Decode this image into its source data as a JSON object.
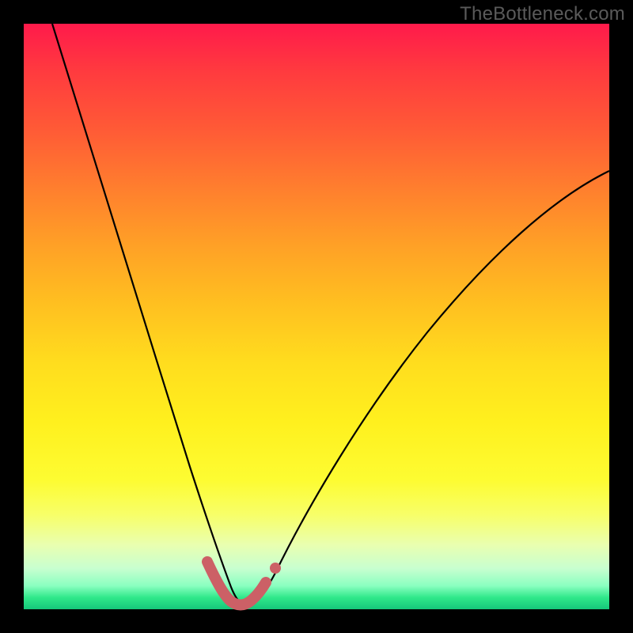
{
  "watermark": "TheBottleneck.com",
  "colors": {
    "curve": "#000000",
    "highlight": "#cc6066",
    "gradient_top": "#ff1a4b",
    "gradient_bottom": "#16c77a",
    "frame": "#000000"
  },
  "chart_data": {
    "type": "line",
    "title": "",
    "xlabel": "",
    "ylabel": "",
    "xlim": [
      0,
      100
    ],
    "ylim": [
      0,
      100
    ],
    "note": "V-shaped bottleneck curve on rainbow gradient; no axis ticks or numeric labels rendered. Values below are estimated from pixel geometry (y = 0 at bottom, 100 at top).",
    "series": [
      {
        "name": "bottleneck-curve",
        "x": [
          5,
          10,
          15,
          20,
          25,
          28,
          30,
          32,
          34,
          35,
          37,
          40,
          45,
          50,
          55,
          60,
          65,
          70,
          75,
          80,
          85,
          90,
          95,
          100
        ],
        "y": [
          100,
          82,
          63,
          44,
          25,
          13,
          7,
          3,
          1,
          0,
          0,
          2,
          9,
          18,
          26,
          33,
          39,
          45,
          50,
          54,
          58,
          61,
          64,
          66
        ]
      },
      {
        "name": "valley-highlight",
        "x": [
          30,
          32,
          34,
          36,
          38,
          40
        ],
        "y": [
          6,
          2,
          0,
          0,
          1,
          4
        ]
      }
    ],
    "markers": [
      {
        "name": "valley-end-dot",
        "x": 41.5,
        "y": 6
      }
    ]
  }
}
